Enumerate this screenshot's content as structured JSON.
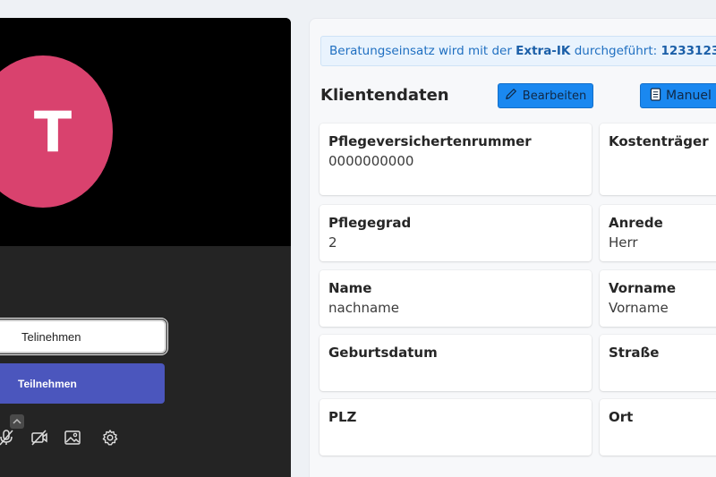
{
  "video": {
    "avatar_initial": "T",
    "avatar_color": "#d9426e",
    "join_outline_label": "Telinehmen",
    "join_primary_label": "Teilnehmen",
    "controls": [
      "chevron-up-icon",
      "mic-off-icon",
      "camera-off-icon",
      "background-image-icon",
      "gear-icon"
    ]
  },
  "banner": {
    "prefix": "Beratungseinsatz wird mit der ",
    "ik_label": "Extra-IK",
    "middle": " durchgeführt: ",
    "ik_number": "1233123"
  },
  "client": {
    "title": "Klientendaten",
    "edit_label": "Bearbeiten",
    "manual_label": "Manuel",
    "fields": [
      {
        "label": "Pflegeversichertenrummer",
        "value": "0000000000"
      },
      {
        "label": "Kostenträger",
        "value": ""
      },
      {
        "label": "Pflegegrad",
        "value": "2"
      },
      {
        "label": "Anrede",
        "value": "Herr"
      },
      {
        "label": "Name",
        "value": "nachname"
      },
      {
        "label": "Vorname",
        "value": "Vorname"
      },
      {
        "label": "Geburtsdatum",
        "value": ""
      },
      {
        "label": "Straße",
        "value": ""
      },
      {
        "label": "PLZ",
        "value": ""
      },
      {
        "label": "Ort",
        "value": ""
      }
    ]
  },
  "colors": {
    "primary_button": "#1a88f0",
    "join_button": "#4b56bd",
    "banner_bg": "#e9f3fd",
    "banner_text": "#1f6fc1"
  }
}
